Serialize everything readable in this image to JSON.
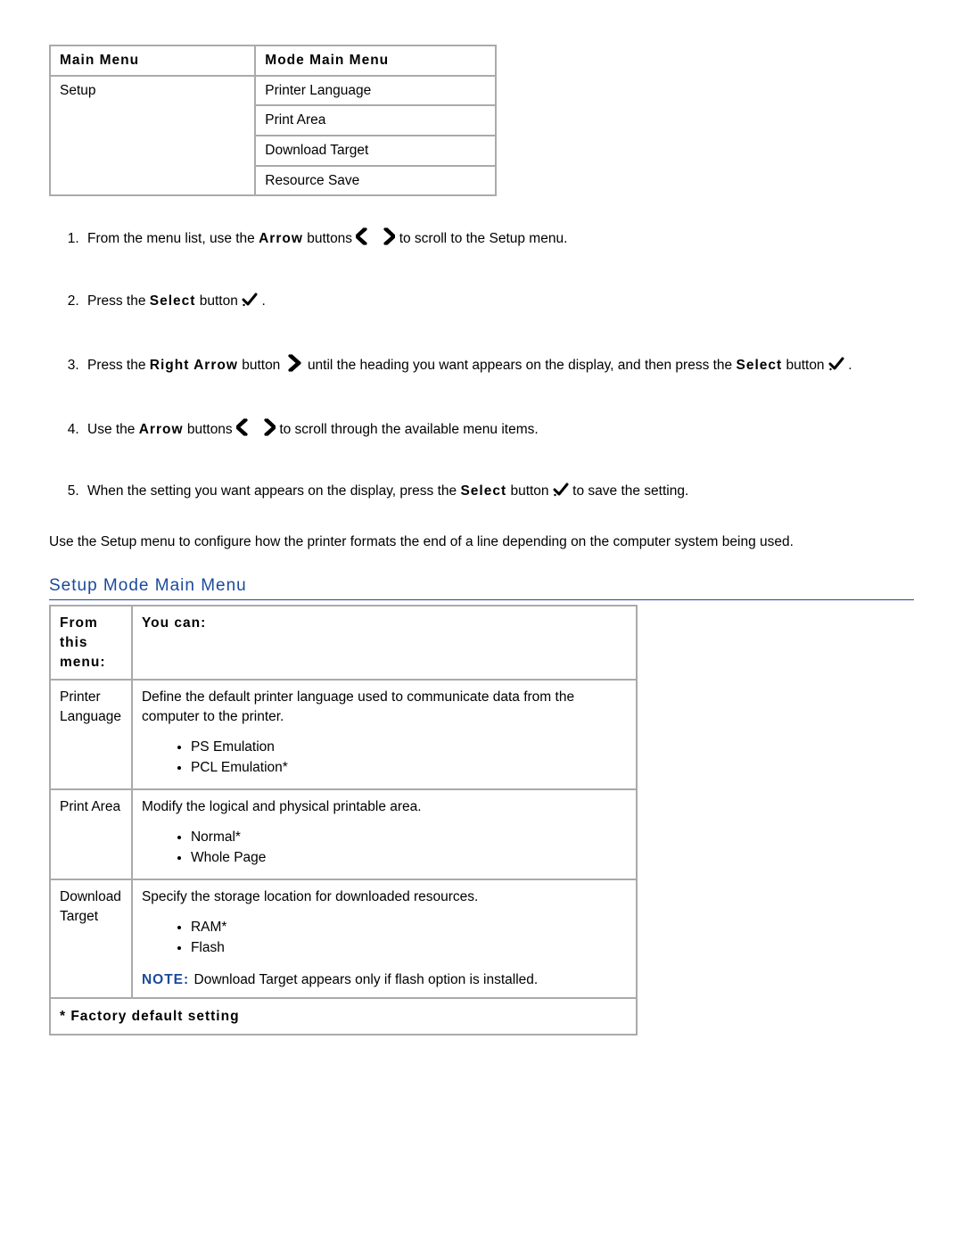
{
  "menu_table": {
    "headers": [
      "Main Menu",
      "Mode Main Menu"
    ],
    "left": "Setup",
    "right_items": [
      "Printer Language",
      "Print Area",
      "Download Target",
      "Resource Save"
    ]
  },
  "steps": {
    "s1_a": "From the menu list, use the ",
    "s1_b": "Arrow",
    "s1_c": " buttons ",
    "s1_d": " to scroll to the Setup menu.",
    "s2_a": "Press the ",
    "s2_b": "Select",
    "s2_c": " button ",
    "s2_d": ".",
    "s3_a": "Press the ",
    "s3_b": "Right Arrow",
    "s3_c": " button ",
    "s3_d": " until the heading you want appears on the display, and then press the ",
    "s3_e": "Select",
    "s3_f": " button ",
    "s3_g": ".",
    "s4_a": "Use the ",
    "s4_b": "Arrow",
    "s4_c": " buttons ",
    "s4_d": " to scroll through the available menu items.",
    "s5_a": "When the setting you want appears on the display, press the ",
    "s5_b": "Select",
    "s5_c": " button ",
    "s5_d": " to save the setting."
  },
  "para": "Use the Setup menu to configure how the printer formats the end of a line depending on the computer system being used.",
  "section_heading": "Setup Mode Main Menu",
  "setup_table": {
    "header_left": "From this menu:",
    "header_right": "You can:",
    "rows": [
      {
        "left": "Printer Language",
        "desc": "Define the default printer language used to communicate data from the computer to the printer.",
        "items": [
          "PS Emulation",
          "PCL Emulation*"
        ]
      },
      {
        "left": "Print Area",
        "desc": "Modify the logical and physical printable area.",
        "items": [
          "Normal*",
          "Whole Page"
        ]
      },
      {
        "left": "Download Target",
        "desc": "Specify the storage location for downloaded resources.",
        "items": [
          "RAM*",
          "Flash"
        ],
        "note_label": "NOTE: ",
        "note_text": " Download Target appears only if flash option is installed."
      }
    ],
    "footer": "* Factory default setting"
  }
}
